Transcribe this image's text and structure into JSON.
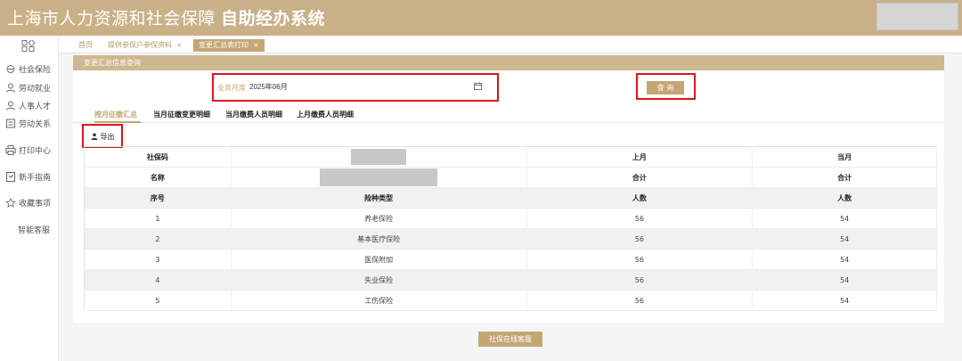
{
  "header": {
    "title_main": "上海市人力资源和社会保障",
    "title_bold": "自助经办系统"
  },
  "sidebar": {
    "items": [
      {
        "label": "社会保险",
        "icon": "insurance-icon"
      },
      {
        "label": "劳动就业",
        "icon": "employment-icon"
      },
      {
        "label": "人事人才",
        "icon": "talent-icon"
      },
      {
        "label": "劳动关系",
        "icon": "relations-icon"
      },
      {
        "label": "打印中心",
        "icon": "printer-icon"
      },
      {
        "label": "新手指南",
        "icon": "guide-icon"
      },
      {
        "label": "收藏事项",
        "icon": "star-icon"
      },
      {
        "label": "智能客服",
        "icon": ""
      }
    ]
  },
  "tabs": [
    {
      "label": "首页"
    },
    {
      "label": "提供参保户参保资料"
    },
    {
      "label": "变更汇总表打印"
    }
  ],
  "panel": {
    "title": "变更汇总信息查询",
    "month_label": "业务月度",
    "month_value": "2025年06月",
    "query_label": "查 询"
  },
  "subtabs": [
    {
      "label": "按月征缴汇总"
    },
    {
      "label": "当月征缴变更明细"
    },
    {
      "label": "当月缴费人员明细"
    },
    {
      "label": "上月缴费人员明细"
    }
  ],
  "export_label": "导出",
  "table": {
    "info_rows": [
      {
        "label": "社保码",
        "prev": "上月",
        "curr": "当月"
      },
      {
        "label": "名称",
        "prev": "合计",
        "curr": "合计"
      }
    ],
    "columns": [
      "序号",
      "险种类型",
      "人数",
      "人数"
    ],
    "rows": [
      [
        "1",
        "养老保险",
        "56",
        "54"
      ],
      [
        "2",
        "基本医疗保险",
        "56",
        "54"
      ],
      [
        "3",
        "医保附加",
        "56",
        "54"
      ],
      [
        "4",
        "失业保险",
        "56",
        "54"
      ],
      [
        "5",
        "工伤保险",
        "56",
        "54"
      ]
    ]
  },
  "bottom_button": "社保在线客服",
  "colors": {
    "brand": "#c9b086",
    "accent": "#c4a675",
    "highlight": "#d9161c"
  }
}
